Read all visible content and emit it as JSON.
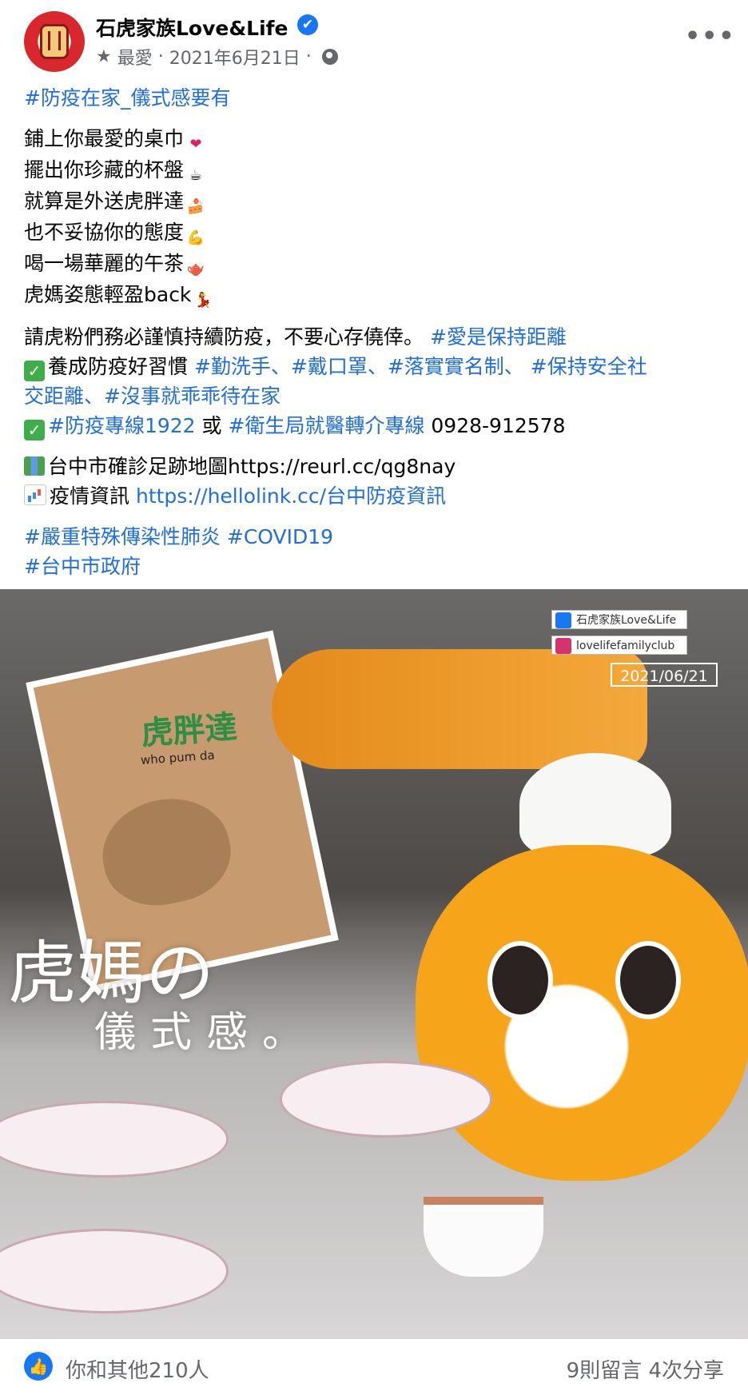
{
  "post": {
    "page_name": "石虎家族Love&Life",
    "verified_mark": "✔",
    "favorite_label": "最愛",
    "date": "2021年6月21日",
    "separator": "·",
    "more_label": "•••"
  },
  "body": {
    "heading_tag": "#防疫在家_儀式感要有",
    "lines": [
      "鋪上你最愛的桌巾",
      "擺出你珍藏的杯盤",
      "就算是外送虎胖達",
      "也不妥協你的態度",
      "喝一場華麗的午茶",
      "虎媽姿態輕盈back"
    ],
    "emoji": [
      "❤",
      "☕",
      "🍰",
      "💪",
      "🫖",
      "💃"
    ],
    "paragraph2": {
      "text": "請虎粉們務必謹慎持續防疫，不要心存僥倖。",
      "tag": "#愛是保持距離"
    },
    "habits": {
      "check": "✓",
      "prefix": "養成防疫好習慣",
      "tags_line1": "#勤洗手、#戴口罩、#落實實名制、 #保持安全社",
      "tags_line2": "交距離、#沒事就乖乖待在家"
    },
    "hotline": {
      "tag1": "#防疫專線1922",
      "or_text": "或",
      "tag2": "#衛生局就醫轉介專線",
      "number": "0928-912578"
    },
    "map_line": "台中市確診足跡地圖https://reurl.cc/qg8nay",
    "info_line": {
      "label": "疫情資訊",
      "link": "https://hellolink.cc/台中防疫資訊"
    },
    "footer_tags_line1": "#嚴重特殊傳染性肺炎 #COVID19",
    "footer_tags_line2": "#台中市政府"
  },
  "photo": {
    "bag_title": "虎胖達",
    "bag_sub": "who pum da",
    "chip_fb": "石虎家族Love&Life",
    "chip_ig": "lovelifefamilyclub",
    "date_badge": "2021/06/21",
    "caption_line1": "虎媽の",
    "caption_line2": "儀式感。"
  },
  "footer": {
    "like_icon": "👍",
    "reactions": "你和其他210人",
    "comments": "9則留言",
    "shares": "4次分享"
  },
  "colors": {
    "link": "#216fdb",
    "meta": "#65676b",
    "brand": "#1877f2"
  }
}
